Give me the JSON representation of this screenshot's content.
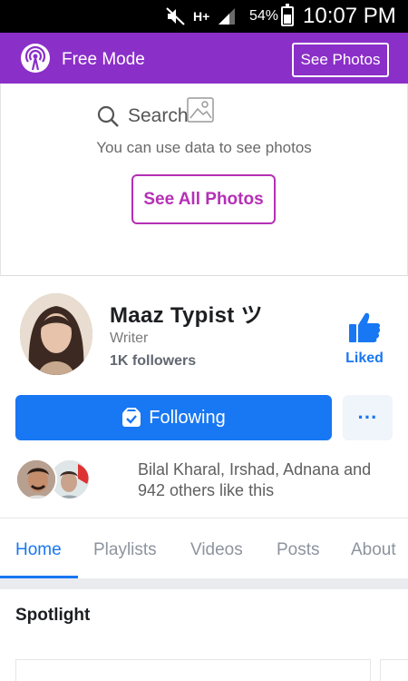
{
  "status_bar": {
    "network": "H+",
    "battery": "54%",
    "battery_level": 0.54,
    "time": "10:07 PM"
  },
  "free_mode": {
    "label": "Free Mode",
    "see_photos": "See Photos",
    "accent": "#8b2fc9"
  },
  "photo_placeholder": {
    "search": "Search",
    "note": "You can use data to see photos",
    "see_all": "See All Photos"
  },
  "profile": {
    "name": "Maaz Typist ツ",
    "category": "Writer",
    "followers": "1K followers",
    "liked": "Liked",
    "following": "Following",
    "more": "···"
  },
  "likes": {
    "text": "Bilal Kharal, Irshad, Adnana and 942 others like this"
  },
  "tabs": [
    "Home",
    "Playlists",
    "Videos",
    "Posts",
    "About"
  ],
  "section": {
    "spotlight": "Spotlight"
  },
  "colors": {
    "brand_blue": "#1877f2",
    "see_all_border": "#b52fb5"
  }
}
